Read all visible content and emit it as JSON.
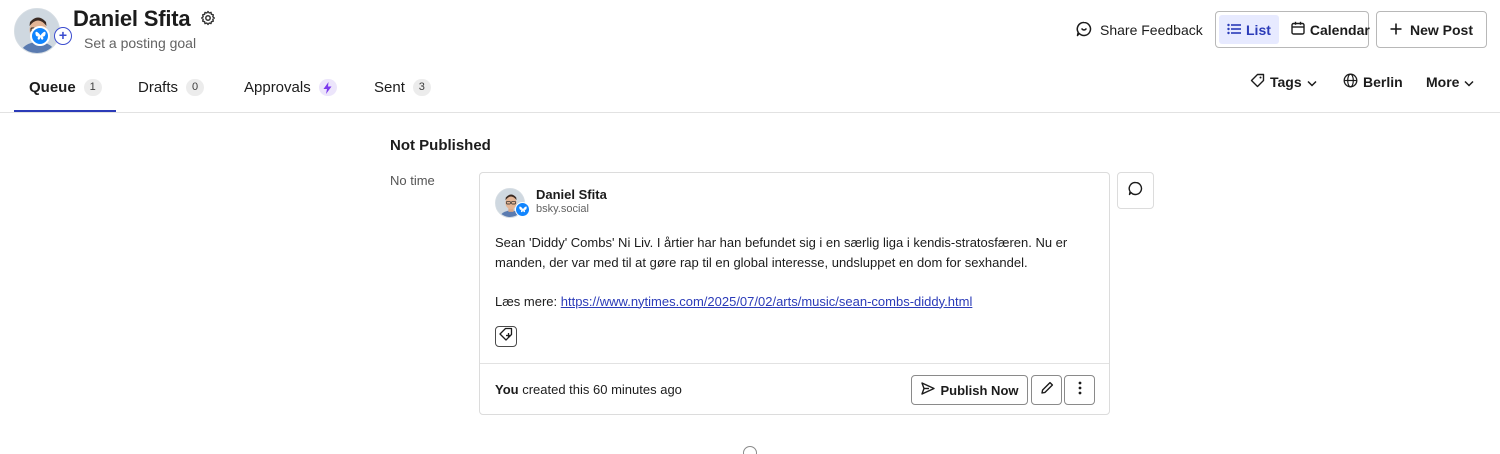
{
  "profile": {
    "name": "Daniel Sfita",
    "posting_goal": "Set a posting goal",
    "network_icon": "bluesky-butterfly-icon",
    "accent_color": "#2b3bb8",
    "network_color": "#1185fe"
  },
  "header_actions": {
    "share_feedback": "Share Feedback",
    "view_list": "List",
    "view_calendar": "Calendar",
    "active_view": "List",
    "new_post": "New Post"
  },
  "tabs": [
    {
      "label": "Queue",
      "count": "1",
      "active": true
    },
    {
      "label": "Drafts",
      "count": "0",
      "active": false
    },
    {
      "label": "Approvals",
      "icon": "lightning-bolt-icon",
      "active": false
    },
    {
      "label": "Sent",
      "count": "3",
      "active": false
    }
  ],
  "toolbar": {
    "tags": "Tags",
    "timezone": "Berlin",
    "more": "More"
  },
  "queue": {
    "section_title": "Not Published",
    "time_label": "No time",
    "post": {
      "author": "Daniel Sfita",
      "handle": "bsky.social",
      "text_line1": "Sean 'Diddy' Combs' Ni Liv. I årtier har han befundet sig i en særlig liga i kendis-stratosfæren. Nu er",
      "text_line2": "manden, der var med til at gøre rap til en global interesse, undsluppet en dom for sexhandel.",
      "read_more_label": "Læs mere: ",
      "link": "https://www.nytimes.com/2025/07/02/arts/music/sean-combs-diddy.html",
      "created_by": "You",
      "created_text": " created this 60 minutes ago",
      "publish_now": "Publish Now"
    }
  }
}
